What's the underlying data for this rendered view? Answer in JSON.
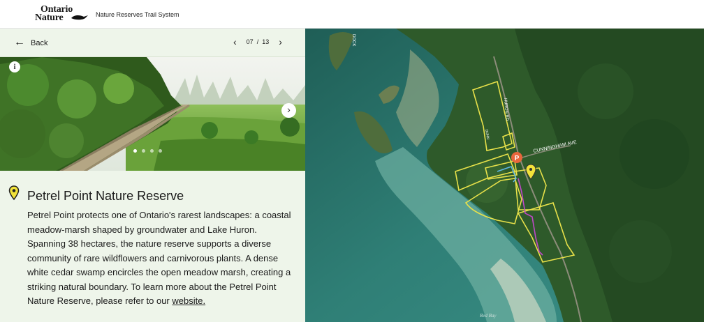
{
  "header": {
    "logo_line1": "Ontario",
    "logo_line2": "Nature",
    "site_title": "Nature Reserves Trail System"
  },
  "nav": {
    "back_label": "Back",
    "pager_current": "07",
    "pager_separator": "/",
    "pager_total": "13"
  },
  "carousel": {
    "info_icon": "info-icon",
    "dots": 4,
    "active_dot": 1
  },
  "reserve": {
    "title": "Petrel Point Nature Reserve",
    "description": "Petrel Point protects one of Ontario's rarest landscapes: a coastal meadow-marsh shaped by groundwater and Lake Huron. Spanning 38 hectares, the nature reserve supports a diverse community of rare wildflowers and carnivorous plants. A dense white cedar swamp encircles the open meadow marsh, creating a striking natural boundary. To learn more about the Petrel Point Nature Reserve, please refer to our",
    "link_text": "website."
  },
  "map": {
    "labels": {
      "road1": "CUNNINGHAM AVE",
      "road2": "HURON RD",
      "road3": "DOCK",
      "road4": "DUNN",
      "bay": "Red Bay"
    },
    "parking_label": "P",
    "colors": {
      "boundary": "#e8e14a",
      "trail_blue": "#5fb8e8",
      "trail_pink": "#c048c8",
      "parking": "#e8663c"
    }
  }
}
